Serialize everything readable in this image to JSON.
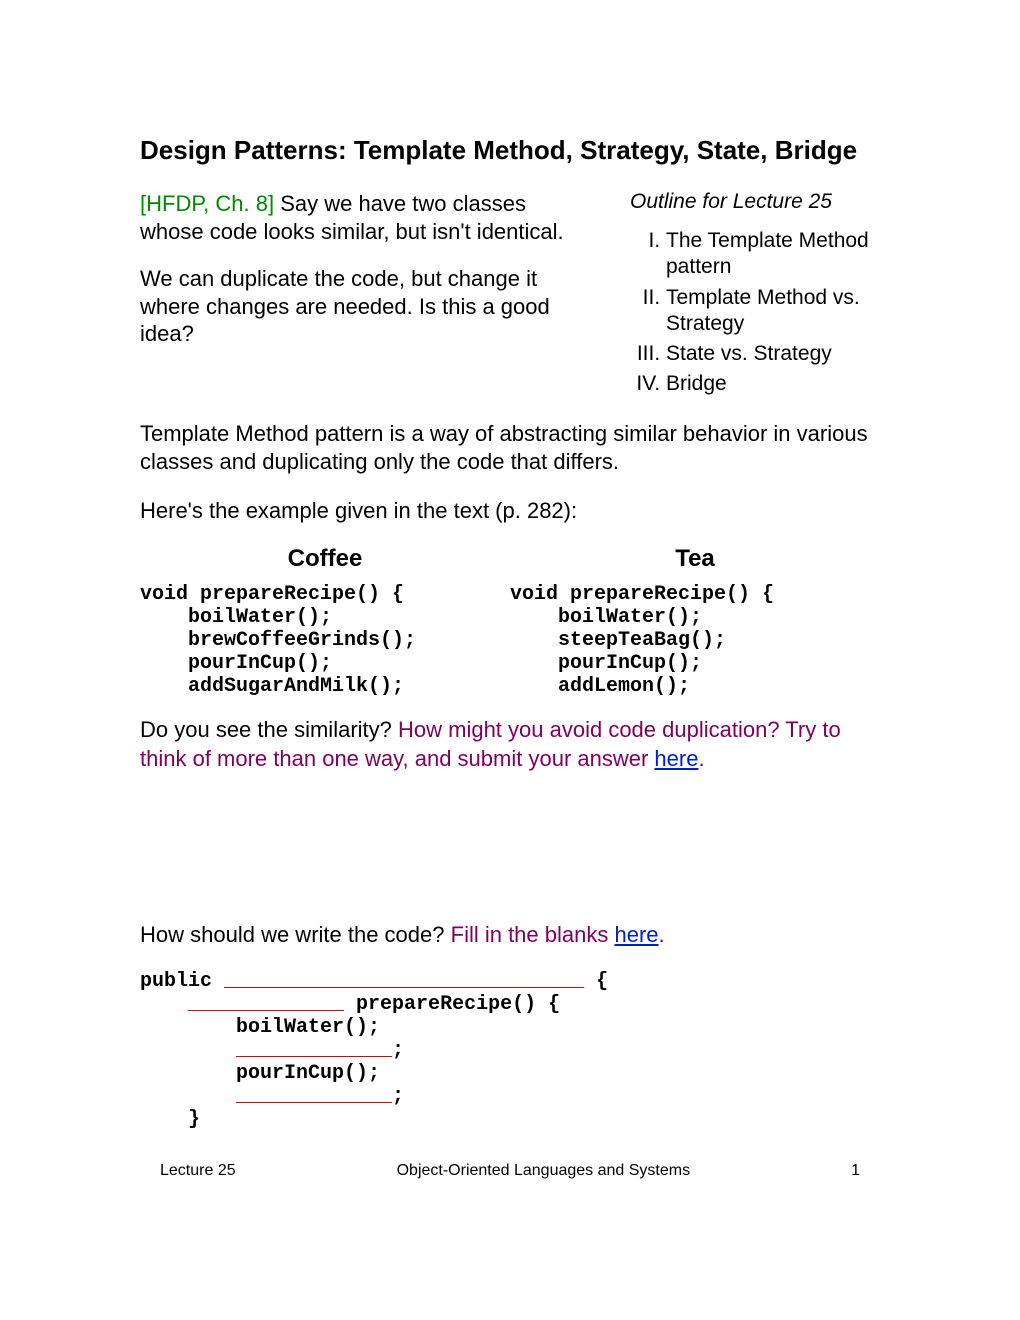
{
  "title": "Design Patterns: Template Method, Strategy, State, Bridge",
  "ref": "[HFDP, Ch. 8]",
  "intro1a": "  Say we have two classes whose code looks similar, but isn't identical.",
  "intro2": "We can duplicate the code, but change it where changes are needed.  Is this a good idea?",
  "outline": {
    "title": "Outline for Lecture 25",
    "items": [
      "The Template Method pattern",
      "Template Method vs. Strategy",
      "State vs. Strategy",
      "Bridge"
    ]
  },
  "para1": "Template Method pattern is a way of abstracting similar behavior in various classes and duplicating only the code that differs.",
  "para2": "Here's the example given in the text (p. 282):",
  "coffee": {
    "head": "Coffee",
    "code": "void prepareRecipe() {\n    boilWater();\n    brewCoffeeGrinds();\n    pourInCup();\n    addSugarAndMilk();"
  },
  "tea": {
    "head": "Tea",
    "code": "void prepareRecipe() {\n    boilWater();\n    steepTeaBag();\n    pourInCup();\n    addLemon();"
  },
  "q1_plain": "Do you see the similarity?  ",
  "q1_prompt": "How might you avoid code duplication?  Try to think of more than one way, and submit your answer ",
  "q2_plain": "How should we write the code?  ",
  "q2_prompt": "Fill in the blanks ",
  "link": "here",
  "period": ".",
  "code2": {
    "l1a": "public ",
    "l1b": "______________________________",
    "l1c": " {",
    "l2a": "    ",
    "l2b": "_____________",
    "l2c": " prepareRecipe() {",
    "l3": "        boilWater();",
    "l4a": "        ",
    "l4b": "_____________",
    "l4c": ";",
    "l5": "        pourInCup();",
    "l6a": "        ",
    "l6b": "_____________",
    "l6c": ";",
    "l7": "    }"
  },
  "footer": {
    "left": "Lecture 25",
    "center": "Object-Oriented Languages and Systems",
    "right": "1"
  }
}
